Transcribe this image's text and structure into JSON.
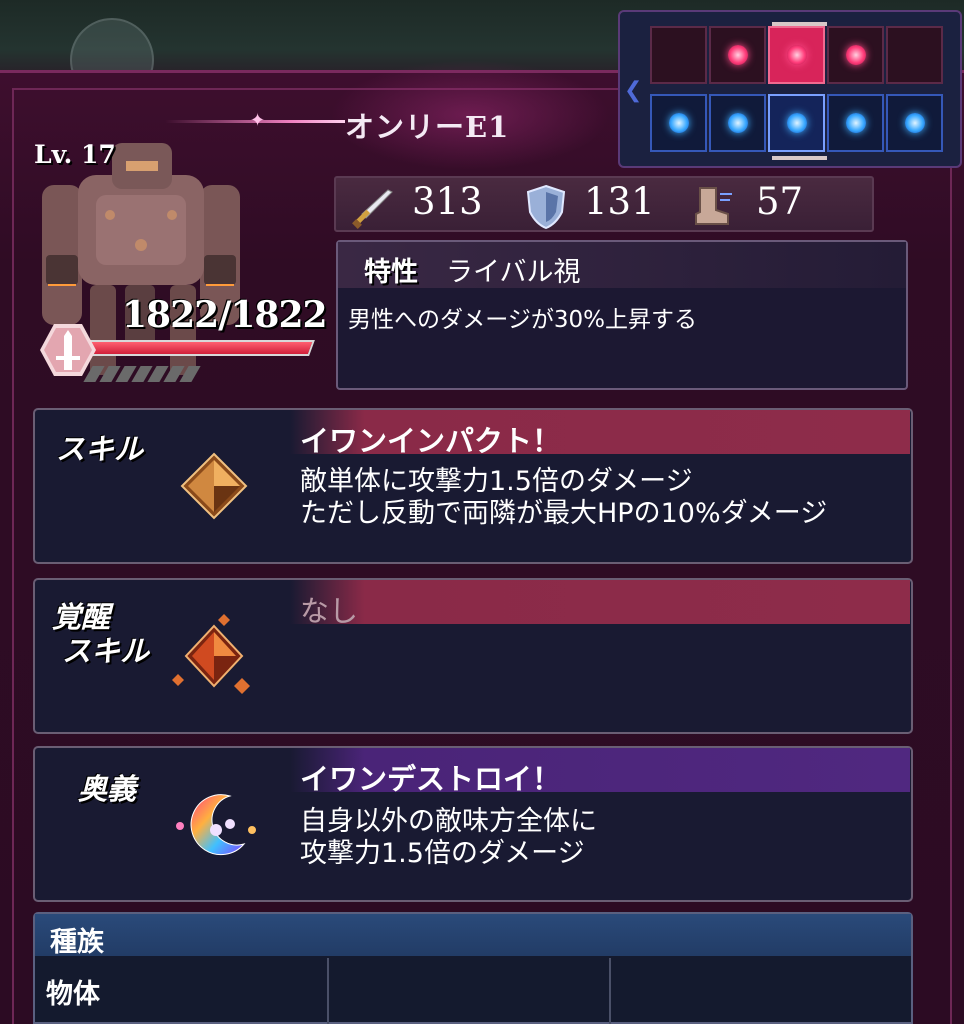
{
  "unit": {
    "name": "オンリーE1",
    "level": "Lv. 17",
    "hp": "1822/1822",
    "hp_fraction": 1.0
  },
  "stats": {
    "attack": "313",
    "defense": "131",
    "speed": "57"
  },
  "formation": {
    "enemy_row": [
      false,
      true,
      true,
      true,
      false
    ],
    "ally_row": [
      true,
      true,
      true,
      true,
      true
    ],
    "selected_column": 2
  },
  "trait": {
    "label": "特性",
    "name": "ライバル視",
    "description": "男性へのダメージが30%上昇する"
  },
  "skill": {
    "kind": "スキル",
    "name": "イワンインパクト！",
    "description_line1": "敵単体に攻撃力1.5倍のダメージ",
    "description_line2": "ただし反動で両隣が最大HPの10%ダメージ"
  },
  "awakening_skill": {
    "kind_line1": "覚醒",
    "kind_line2": "スキル",
    "name": "なし"
  },
  "ultimate": {
    "kind": "奥義",
    "name": "イワンデストロイ！",
    "description_line1": "自身以外の敵味方全体に",
    "description_line2": "攻撃力1.5倍のダメージ"
  },
  "race": {
    "label": "種族",
    "value": "物体"
  },
  "colors": {
    "frame": "#2c0b23",
    "hp_bar": "#d0203a",
    "enemy_dot": "#ff3c7a",
    "ally_dot": "#38a8ff"
  },
  "icons": {
    "attack": "sword-icon",
    "defense": "shield-icon",
    "speed": "boot-icon",
    "skill": "amber-crystal-icon",
    "awakening": "crystal-cluster-icon",
    "ultimate": "crescent-moon-icon",
    "class": "sword-class-badge-icon"
  }
}
